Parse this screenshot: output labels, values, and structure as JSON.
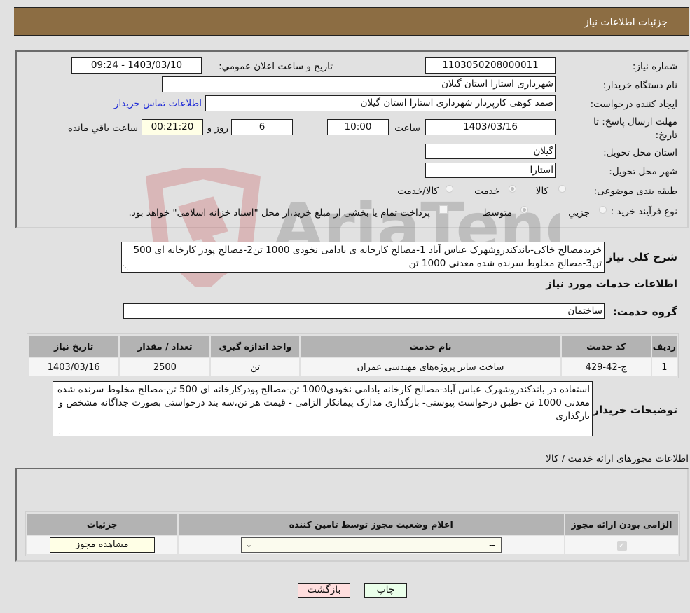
{
  "header": {
    "title": "جزئیات اطلاعات نیاز"
  },
  "form": {
    "need_number": {
      "label": "شماره نیاز:",
      "value": "1103050208000011"
    },
    "announce_datetime": {
      "label": "تاریخ و ساعت اعلان عمومي:",
      "value": "1403/03/10 - 09:24"
    },
    "buyer_org": {
      "label": "نام دستگاه خریدار:",
      "value": "شهرداری استارا استان گیلان"
    },
    "requester": {
      "label": "ایجاد کننده درخواست:",
      "value": "صمد کوهی کارپرداز شهرداری استارا استان گیلان"
    },
    "buyer_contact_link": "اطلاعات تماس خریدار",
    "deadline": {
      "label": "مهلت ارسال پاسخ: تا تاریخ:",
      "date": "1403/03/16",
      "time_label": "ساعت",
      "time": "10:00",
      "days": "6",
      "days_label": "روز و",
      "remaining": "00:21:20",
      "remaining_label": "ساعت باقي مانده"
    },
    "delivery_province": {
      "label": "استان محل تحویل:",
      "value": "گیلان"
    },
    "delivery_city": {
      "label": "شهر محل تحویل:",
      "value": "آستارا"
    },
    "category": {
      "label": "طبقه بندی موضوعی:",
      "options": [
        "کالا",
        "خدمت",
        "کالا/خدمت"
      ],
      "selected": "خدمت"
    },
    "purchase_type": {
      "label": "نوع فرآیند خرید :",
      "options": [
        "جزيي",
        "متوسط"
      ],
      "selected": "متوسط",
      "treasury_note": "پرداخت تمام یا بخشی از مبلغ خرید،از محل \"اسناد خزانه اسلامی\" خواهد بود."
    }
  },
  "description": {
    "label": "شرح کلي نياز:",
    "value": "خریدمصالح خاکی-باندکندروشهرک عباس آباد 1-مصالح کارخانه ی بادامی نخودی 1000 تن2-مصالح پودر کارخانه ای 500 تن3-مصالح مخلوط سرنده شده معدنی 1000 تن"
  },
  "services": {
    "section_title": "اطلاعات خدمات مورد نياز",
    "group_label": "گروه خدمت:",
    "group_value": "ساختمان",
    "columns": [
      "ردیف",
      "کد خدمت",
      "نام خدمت",
      "واحد اندازه گیری",
      "تعداد / مقدار",
      "تاریخ نیاز"
    ],
    "rows": [
      [
        "1",
        "ج-42-429",
        "ساخت سایر پروژه‌های مهندسی عمران",
        "تن",
        "2500",
        "1403/03/16"
      ]
    ]
  },
  "buyer_notes": {
    "label": "توضیحات خریدار:",
    "value": "استفاده در باندکندروشهرک عباس آباد-مصالح کارخانه بادامی نخودی1000 تن-مصالح پودرکارخانه ای 500 تن-مصالح مخلوط سرنده شده معدنی 1000 تن -طبق درخواست پیوستی- بارگذاری مدارک پیمانکار الزامی - قیمت هر تن،سه بند درخواستی بصورت جداگانه مشخص و بارگذاری"
  },
  "permits": {
    "section_title": "اطلاعات مجوزهای ارائه خدمت / کالا",
    "columns": [
      "الزامی بودن ارائه مجوز",
      "اعلام وضعیت مجوز توسط تامین کننده",
      "جزئیات"
    ],
    "row": {
      "required_checked": true,
      "status_select": "--",
      "details_button": "مشاهده مجوز"
    }
  },
  "footer": {
    "print_button": "چاپ",
    "back_button": "بازگشت"
  },
  "watermark": "AriaTender.neT"
}
